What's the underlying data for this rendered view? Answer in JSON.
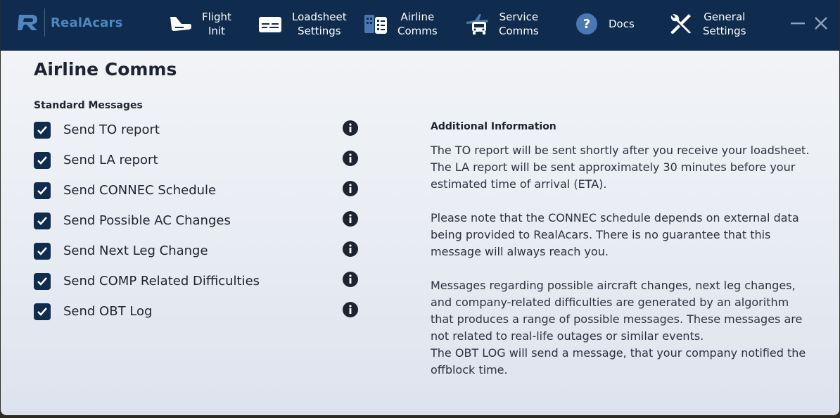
{
  "app": {
    "name": "RealAcars"
  },
  "nav": [
    {
      "label": "Flight\nInit",
      "icon": "airplane-icon"
    },
    {
      "label": "Loadsheet\nSettings",
      "icon": "loadsheet-icon"
    },
    {
      "label": "Airline\nComms",
      "icon": "airline-comms-icon"
    },
    {
      "label": "Service\nComms",
      "icon": "service-comms-icon"
    },
    {
      "label": "Docs",
      "icon": "question-icon"
    },
    {
      "label": "General\nSettings",
      "icon": "tools-icon"
    }
  ],
  "window": {
    "minimize": "minimize-icon",
    "close": "close-icon"
  },
  "page": {
    "title": "Airline Comms",
    "section_label": "Standard Messages"
  },
  "options": [
    {
      "label": "Send TO report",
      "checked": true
    },
    {
      "label": "Send LA report",
      "checked": true
    },
    {
      "label": "Send CONNEC Schedule",
      "checked": true
    },
    {
      "label": "Send Possible AC Changes",
      "checked": true
    },
    {
      "label": "Send Next Leg Change",
      "checked": true
    },
    {
      "label": "Send COMP Related Difficulties",
      "checked": true
    },
    {
      "label": "Send OBT Log",
      "checked": true
    }
  ],
  "info": {
    "heading": "Additional Information",
    "paragraphs": [
      "The TO report will be sent shortly after you receive your loadsheet. The LA report will be sent approximately 30 minutes before your estimated time of arrival (ETA).",
      "Please note that the CONNEC schedule depends on external data being provided to RealAcars. There is no guarantee that this message will always reach you.",
      "Messages regarding possible aircraft changes, next leg changes, and company-related difficulties are generated by an algorithm that produces a range of possible messages. These messages are not related to real-life outages or similar events.",
      "The OBT LOG will send a message, that your company notified the offblock time."
    ]
  },
  "colors": {
    "accent": "#0f2b4d",
    "logo": "#4f86c2",
    "background": "#eef1f6"
  }
}
